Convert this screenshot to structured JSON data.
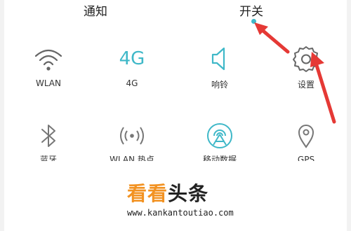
{
  "tabs": {
    "notify": "通知",
    "switch": "开关"
  },
  "colors": {
    "accent": "#3fb8c8",
    "arrow": "#e53935",
    "watermark_orange": "#f29222"
  },
  "tiles": [
    {
      "label": "WLAN",
      "icon": "wifi-icon"
    },
    {
      "label": "4G",
      "icon": "4g-icon",
      "glyph": "4G"
    },
    {
      "label": "响铃",
      "icon": "speaker-icon"
    },
    {
      "label": "设置",
      "icon": "gear-icon"
    },
    {
      "label": "蓝牙",
      "icon": "bluetooth-icon"
    },
    {
      "label": "WLAN 热点",
      "icon": "hotspot-icon"
    },
    {
      "label": "移动数据",
      "icon": "mobile-data-icon"
    },
    {
      "label": "GPS",
      "icon": "location-icon"
    }
  ],
  "watermark": {
    "brand_a": "看看",
    "brand_b": "头条",
    "url": "www.kankantoutiao.com"
  }
}
